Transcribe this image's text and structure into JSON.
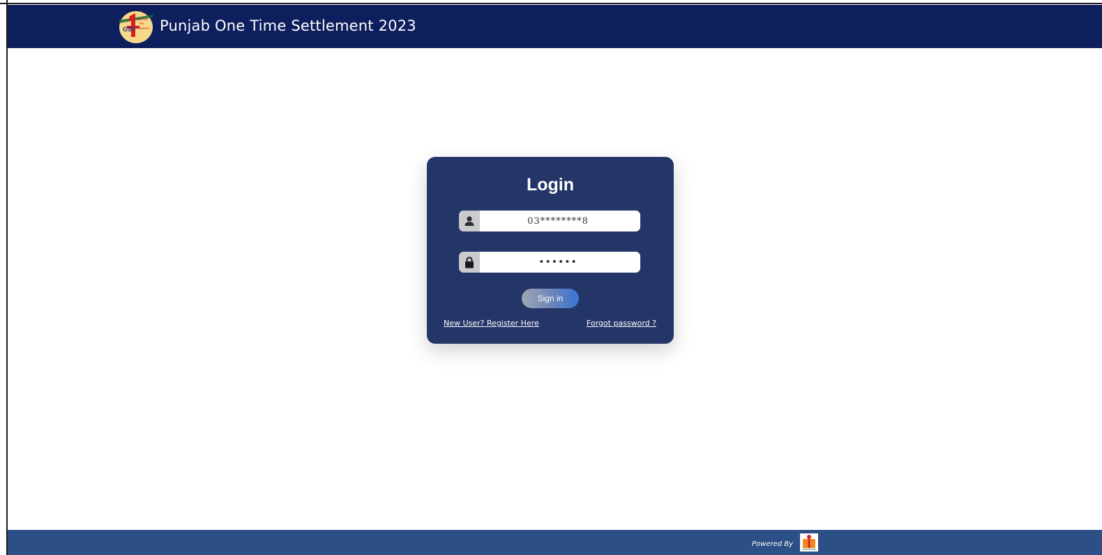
{
  "header": {
    "title": "Punjab One Time Settlement 2023",
    "logo_icon": "gst-one-nation-one-tax-logo",
    "logo_text": "ONE NATION ONE TAX ONE MARKET GST"
  },
  "login": {
    "title": "Login",
    "username_value": "03********8",
    "password_value": "••••••",
    "username_icon": "user-icon",
    "password_icon": "lock-icon",
    "signin_label": "Sign in",
    "register_link": "New User? Register Here",
    "forgot_link": "Forgot password ?"
  },
  "footer": {
    "powered_by": "Powered By",
    "provider_logo": "provider-logo-icon"
  },
  "colors": {
    "header_bg": "#0d1f5c",
    "card_bg": "#243567",
    "footer_bg": "#2c4f85",
    "button_gradient_end": "#3a74d4"
  }
}
